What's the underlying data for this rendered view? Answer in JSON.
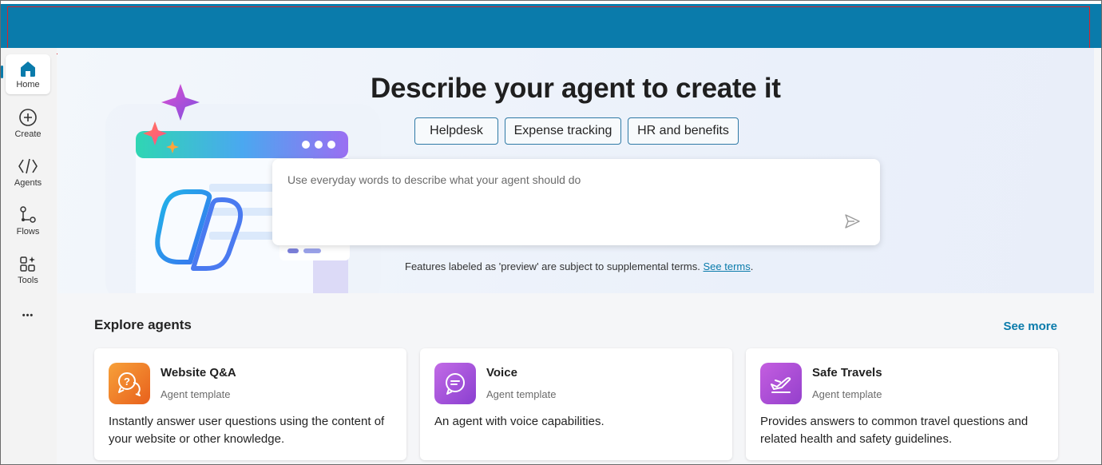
{
  "sidebar": {
    "items": [
      {
        "label": "Home",
        "icon": "home-icon"
      },
      {
        "label": "Create",
        "icon": "plus-circle-icon"
      },
      {
        "label": "Agents",
        "icon": "code-icon"
      },
      {
        "label": "Flows",
        "icon": "flow-icon"
      },
      {
        "label": "Tools",
        "icon": "tools-icon"
      }
    ],
    "more_label": "•••"
  },
  "hero": {
    "title": "Describe your agent to create it",
    "chips": [
      "Helpdesk",
      "Expense tracking",
      "HR and benefits"
    ],
    "prompt_placeholder": "Use everyday words to describe what your agent should do",
    "terms_text": "Features labeled as 'preview' are subject to supplemental terms.",
    "terms_link": "See terms",
    "terms_period": "."
  },
  "explore": {
    "title": "Explore agents",
    "see_more": "See more",
    "cards": [
      {
        "title": "Website Q&A",
        "subtitle": "Agent template",
        "description": "Instantly answer user questions using the content of your website or other knowledge.",
        "icon": "qa-chat-icon",
        "color": "#f07b1f"
      },
      {
        "title": "Voice",
        "subtitle": "Agent template",
        "description": "An agent with voice capabilities.",
        "icon": "voice-chat-icon",
        "color": "#a94fd6"
      },
      {
        "title": "Safe Travels",
        "subtitle": "Agent template",
        "description": "Provides answers to common travel questions and related health and safety guidelines.",
        "icon": "airplane-icon",
        "color": "#b14fd4"
      }
    ]
  },
  "colors": {
    "topbar": "#0a7bab",
    "accent": "#0a7bab"
  }
}
